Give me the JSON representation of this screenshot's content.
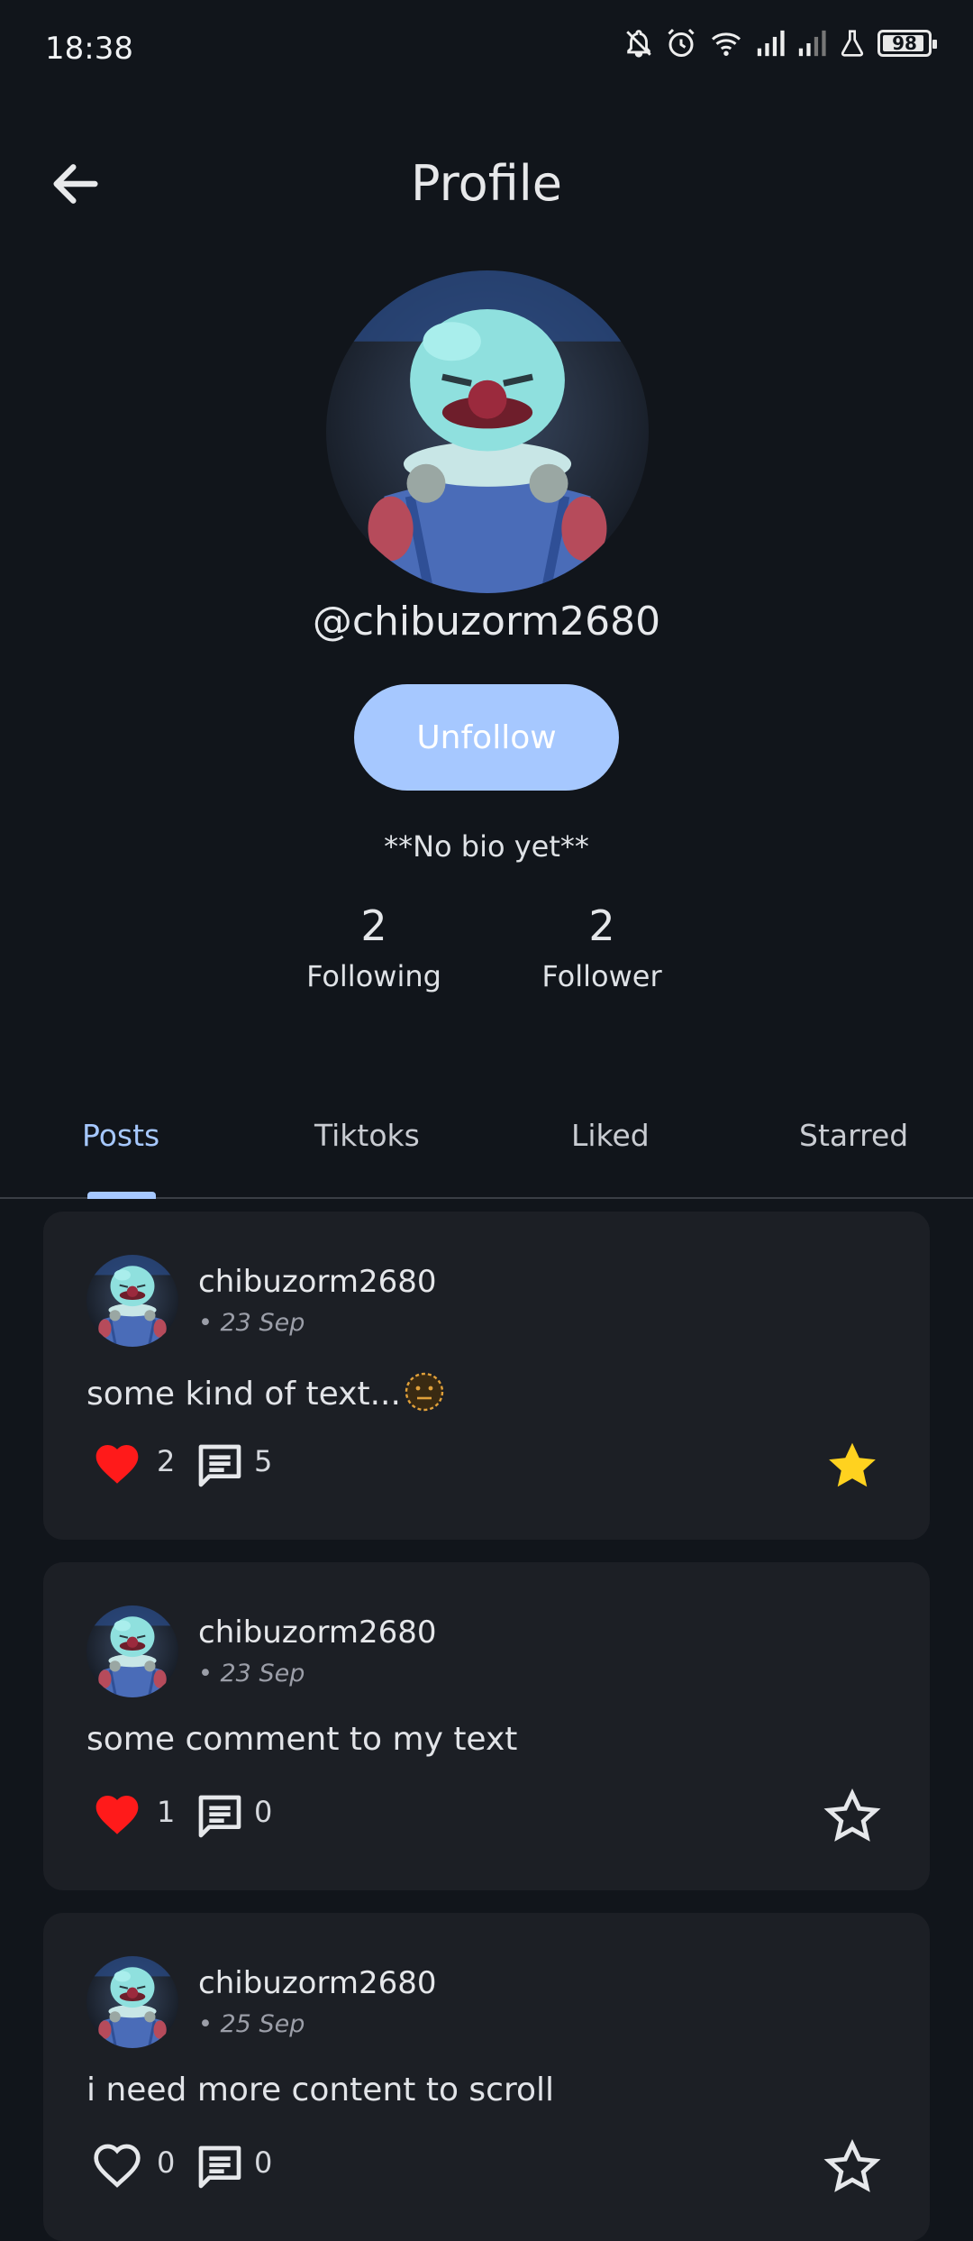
{
  "status_bar": {
    "time": "18:38",
    "battery": "98",
    "icons": [
      "bell-off-icon",
      "alarm-icon",
      "wifi-icon",
      "signal-icon",
      "signal-weak-icon",
      "flask-icon",
      "battery-icon"
    ]
  },
  "header": {
    "title": "Profile",
    "back_icon": "arrow-left-icon"
  },
  "profile": {
    "username": "@chibuzorm2680",
    "follow_button": "Unfollow",
    "bio": "**No bio yet**",
    "following_count": "2",
    "following_label": "Following",
    "follower_count": "2",
    "follower_label": "Follower"
  },
  "tabs": [
    {
      "label": "Posts",
      "active": true
    },
    {
      "label": "Tiktoks",
      "active": false
    },
    {
      "label": "Liked",
      "active": false
    },
    {
      "label": "Starred",
      "active": false
    }
  ],
  "posts": [
    {
      "author": "chibuzorm2680",
      "date": "• 23 Sep",
      "text": "some kind of text...",
      "emoji": "neutral-face-icon",
      "likes": "2",
      "liked": true,
      "comments": "5",
      "starred": true
    },
    {
      "author": "chibuzorm2680",
      "date": "• 23 Sep",
      "text": "some comment to my text",
      "likes": "1",
      "liked": true,
      "comments": "0",
      "starred": false
    },
    {
      "author": "chibuzorm2680",
      "date": "• 25 Sep",
      "text": "i need more content to scroll",
      "likes": "0",
      "liked": false,
      "comments": "0",
      "starred": false
    }
  ],
  "colors": {
    "accent": "#a6c8ff",
    "background": "#11151b",
    "card": "#1c1f25",
    "like_red": "#ff1a1a",
    "star_gold": "#ffd21f"
  }
}
